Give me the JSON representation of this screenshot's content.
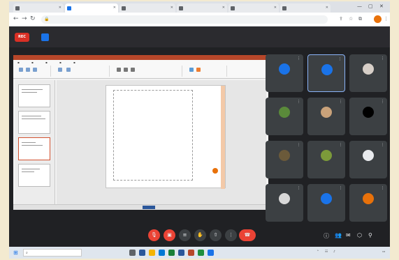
{
  "browser": {
    "tabs": [
      {
        "label": "",
        "active": false
      },
      {
        "label": "",
        "active": true
      },
      {
        "label": "",
        "active": false
      },
      {
        "label": "",
        "active": false
      },
      {
        "label": "",
        "active": false
      },
      {
        "label": "",
        "active": false
      }
    ],
    "url": "",
    "window_controls": {
      "minimize": "—",
      "maximize": "▢",
      "close": "✕"
    }
  },
  "meeting": {
    "rec_label": "REC",
    "title": "",
    "time": "",
    "participants": [
      {
        "name": "",
        "avatar_color": "#1a73e8",
        "active": false
      },
      {
        "name": "",
        "avatar_color": "#1a73e8",
        "active": true
      },
      {
        "name": "",
        "avatar_color": "#d7cfc8",
        "active": false
      },
      {
        "name": "",
        "avatar_color": "#5a8a3a",
        "active": false
      },
      {
        "name": "",
        "avatar_color": "#c9a27a",
        "active": false
      },
      {
        "name": "",
        "avatar_color": "#000000",
        "active": false
      },
      {
        "name": "",
        "avatar_color": "#6b5a3a",
        "active": false
      },
      {
        "name": "",
        "avatar_color": "#7c9a3a",
        "active": false
      },
      {
        "name": "",
        "avatar_color": "#e8eaed",
        "active": false
      },
      {
        "name": "",
        "avatar_color": "#d8d8d8",
        "active": false
      },
      {
        "name": "",
        "avatar_color": "#1a73e8",
        "active": false
      },
      {
        "name": "",
        "avatar_color": "#e8710a",
        "active": false
      }
    ]
  },
  "slide": {
    "code_lines": [
      "",
      "",
      "",
      "",
      "",
      "",
      "",
      "",
      "",
      "",
      ""
    ]
  },
  "taskbar": {
    "search_placeholder": "",
    "clock": ""
  },
  "colors": {
    "record_red": "#d93025",
    "meet_accent": "#1a73e8",
    "ppt_orange": "#b7472a"
  }
}
